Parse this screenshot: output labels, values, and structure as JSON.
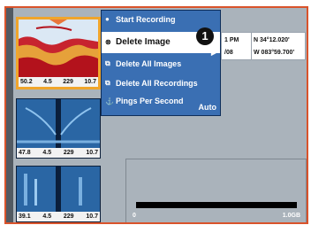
{
  "menu": {
    "items": [
      {
        "label": "Start Recording"
      },
      {
        "label": "Delete Image"
      },
      {
        "label": "Delete All Images"
      },
      {
        "label": "Delete All Recordings"
      },
      {
        "label": "Pings Per Second",
        "value": "Auto"
      }
    ],
    "callout": "1"
  },
  "nav": {
    "time": "1 PM",
    "date": "/08",
    "latitude": "N 34°12.020'",
    "longitude": "W 083°59.700'"
  },
  "thumbnails": [
    {
      "depth": "50.2",
      "speed": "4.5",
      "heading": "229",
      "temp": "10.7"
    },
    {
      "depth": "47.8",
      "speed": "4.5",
      "heading": "229",
      "temp": "10.7"
    },
    {
      "depth": "39.1",
      "speed": "4.5",
      "heading": "229",
      "temp": "10.7"
    }
  ],
  "scale": {
    "min": "0",
    "max": "1.0GB"
  },
  "colors": {
    "frame": "#d9532b",
    "menu": "#3a6fb3",
    "thumb_highlight": "#f0a52b"
  }
}
